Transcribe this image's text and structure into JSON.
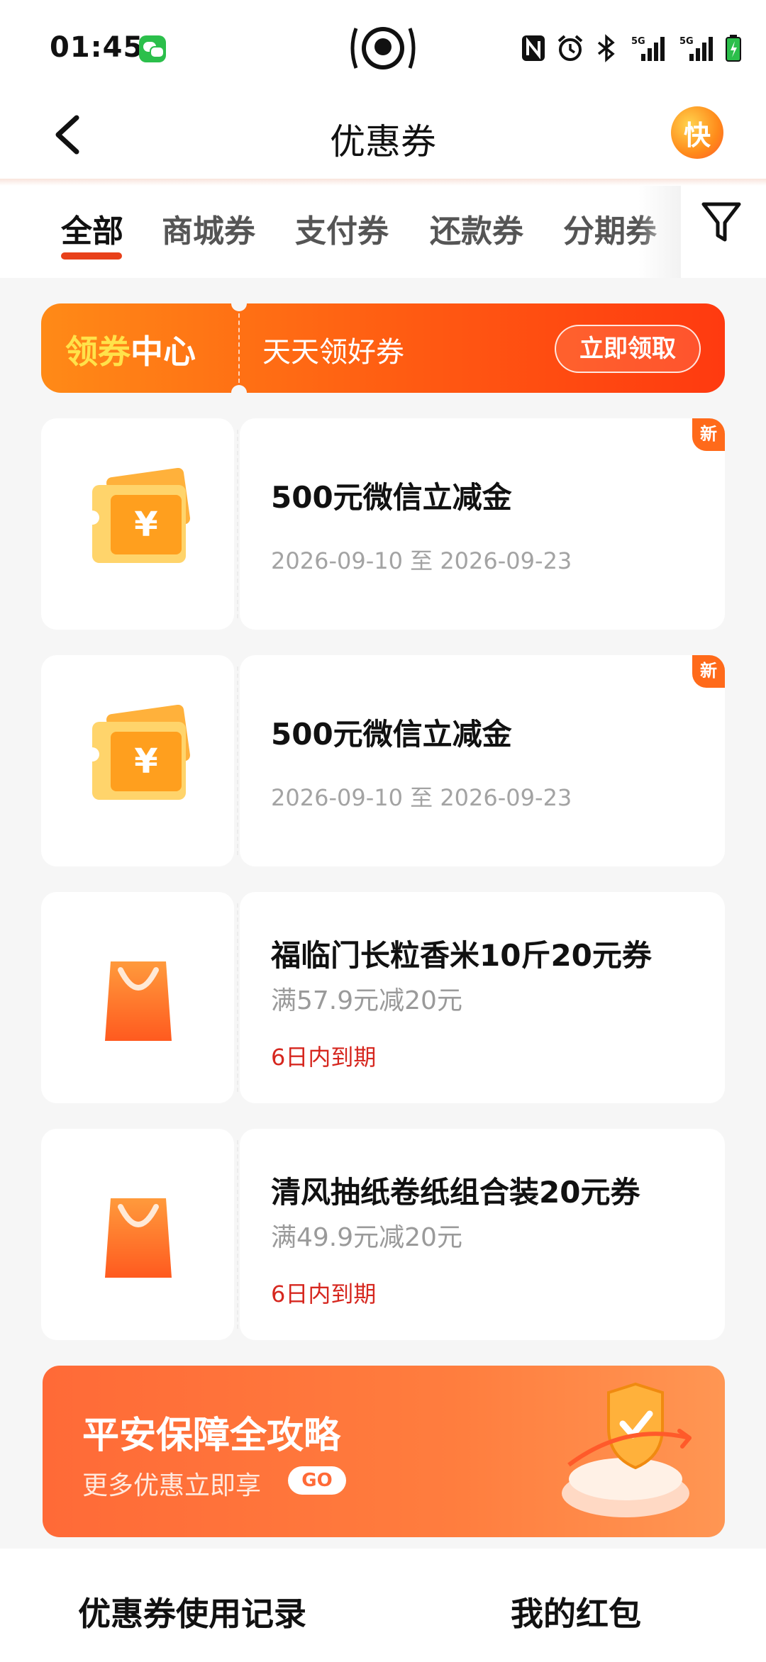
{
  "status_bar": {
    "time": "01:45",
    "icons": [
      "wechat-icon",
      "nfc-icon",
      "alarm-icon",
      "bluetooth-icon",
      "signal-5g-icon",
      "signal-5g-icon",
      "battery-charging-icon"
    ]
  },
  "header": {
    "title": "优惠券",
    "right_badge": "快"
  },
  "tabs": [
    {
      "label": "全部",
      "active": true
    },
    {
      "label": "商城券",
      "active": false
    },
    {
      "label": "支付券",
      "active": false
    },
    {
      "label": "还款券",
      "active": false
    },
    {
      "label": "分期券",
      "active": false
    }
  ],
  "banner": {
    "title_part1": "领券",
    "title_part2": "中心",
    "subtitle": "天天领好券",
    "button": "立即领取"
  },
  "coupons": [
    {
      "icon": "yuan-ticket-icon",
      "title": "500元微信立减金",
      "date": "2026-09-10 至 2026-09-23",
      "badge": "新"
    },
    {
      "icon": "yuan-ticket-icon",
      "title": "500元微信立减金",
      "date": "2026-09-10 至 2026-09-23",
      "badge": "新"
    },
    {
      "icon": "shopping-bag-icon",
      "title": "福临门长粒香米10斤20元券",
      "condition": "满57.9元减20元",
      "expiry": "6日内到期"
    },
    {
      "icon": "shopping-bag-icon",
      "title": "清风抽纸卷纸组合装20元券",
      "condition": "满49.9元减20元",
      "expiry": "6日内到期"
    }
  ],
  "promo": {
    "title": "平安保障全攻略",
    "subtitle": "更多优惠立即享",
    "go": "GO"
  },
  "bottom": {
    "left": "优惠券使用记录",
    "right": "我的红包"
  },
  "colors": {
    "accent": "#e8401a",
    "expiry_red": "#d6271f",
    "banner_orange": "#ff5a12"
  }
}
